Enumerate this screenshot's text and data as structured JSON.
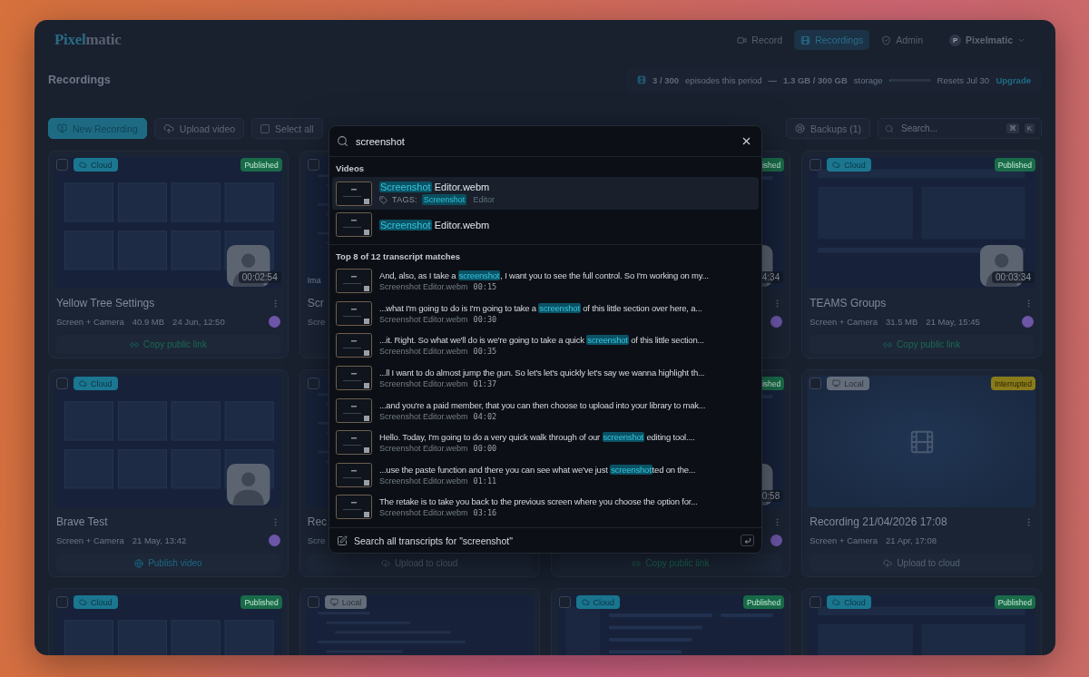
{
  "app": {
    "logo": [
      {
        "text": "Pixel",
        "accent": true
      },
      {
        "text": "matic",
        "accent": false
      }
    ],
    "nav": [
      {
        "label": "Record",
        "selected": false
      },
      {
        "label": "Recordings",
        "selected": true
      },
      {
        "label": "Admin",
        "selected": false
      }
    ],
    "user": {
      "initial": "P",
      "name": "Pixelmatic"
    }
  },
  "header": {
    "title": "Recordings",
    "usage": {
      "count": "3 / 300",
      "count_label": "episodes this period",
      "dash": "—",
      "storage": "1.3 GB / 300 GB",
      "storage_label": "storage",
      "level": 0.02,
      "resets": "Resets Jul 30",
      "upgrade": "Upgrade"
    }
  },
  "toolbar": {
    "new_recording": "New Recording",
    "upload": "Upload video",
    "select_all": {
      "label": "Select all",
      "checked": false
    },
    "backups": "Backups (1)",
    "search": {
      "placeholder": "Search...",
      "keys": [
        "⌘",
        "K"
      ]
    }
  },
  "cards": [
    {
      "checked": false,
      "storage": {
        "kind": "cloud",
        "label": "Cloud"
      },
      "status": {
        "kind": "published",
        "label": "Published"
      },
      "duration": "00:02:54",
      "title": "Yellow Tree Settings",
      "meta": [
        "Screen + Camera",
        "40.9 MB",
        "24 Jun, 12:50"
      ],
      "avatar": true,
      "menu": true,
      "action": {
        "kind": "link",
        "label": "Copy public link"
      }
    },
    {
      "checked": false,
      "thumb_tag": "Ima",
      "title": "Scr",
      "meta": [
        "Scre"
      ]
    },
    {
      "status": {
        "kind": "published",
        "label": "ished"
      },
      "duration": "4:34",
      "avatar": true,
      "menu": true
    },
    {
      "checked": false,
      "storage": {
        "kind": "cloud",
        "label": "Cloud"
      },
      "status": {
        "kind": "published",
        "label": "Published"
      },
      "duration": "00:03:34",
      "title": "TEAMS Groups",
      "meta": [
        "Screen + Camera",
        "31.5 MB",
        "21 May, 15:45"
      ],
      "avatar": true,
      "menu": true,
      "action": {
        "kind": "link",
        "label": "Copy public link"
      }
    },
    {
      "checked": false,
      "storage": {
        "kind": "cloud",
        "label": "Cloud"
      },
      "title": "Brave Test",
      "meta": [
        "Screen + Camera",
        "21 May, 13:42"
      ],
      "avatar": true,
      "menu": true,
      "action": {
        "kind": "publish",
        "label": "Publish video"
      }
    },
    {
      "checked": false,
      "title": "Rec",
      "meta": [
        "Scre"
      ],
      "action": {
        "kind": "upload",
        "label": "Upload to cloud"
      }
    },
    {
      "status": {
        "kind": "published",
        "label": "ished"
      },
      "duration": "0:58",
      "avatar": true,
      "menu": true,
      "action": {
        "kind": "link",
        "label": "Copy public link"
      }
    },
    {
      "checked": false,
      "storage": {
        "kind": "local",
        "label": "Local"
      },
      "status": {
        "kind": "interrupted",
        "label": "Interrupted"
      },
      "preview": false,
      "title": "Recording 21/04/2026 17:08",
      "meta": [
        "Screen + Camera",
        "21 Apr, 17:08"
      ],
      "menu": true,
      "action": {
        "kind": "upload",
        "label": "Upload to cloud"
      }
    },
    {
      "checked": false,
      "storage": {
        "kind": "cloud",
        "label": "Cloud"
      },
      "status": {
        "kind": "published",
        "label": "Published"
      }
    },
    {
      "checked": false,
      "storage": {
        "kind": "local",
        "label": "Local"
      }
    },
    {
      "checked": false,
      "storage": {
        "kind": "cloud",
        "label": "Cloud"
      },
      "status": {
        "kind": "published",
        "label": "Published"
      }
    },
    {
      "checked": false,
      "storage": {
        "kind": "cloud",
        "label": "Cloud"
      },
      "status": {
        "kind": "published",
        "label": "Published"
      }
    }
  ],
  "search_dialog": {
    "query": "screenshot",
    "videos_heading": "Videos",
    "videos": [
      {
        "selected": true,
        "name": [
          {
            "text": "Screenshot",
            "match": true
          },
          {
            "text": " Editor.webm",
            "match": false
          }
        ],
        "tags_label": "TAGS:",
        "tags": [
          {
            "text": "Screenshot",
            "match": true
          },
          {
            "text": "Editor",
            "match": false
          }
        ]
      },
      {
        "selected": false,
        "name": [
          {
            "text": "Screenshot",
            "match": true
          },
          {
            "text": " Editor.webm",
            "match": false
          }
        ]
      }
    ],
    "transcripts_heading": "Top 8 of 12 transcript matches",
    "transcripts": [
      {
        "selected": false,
        "text": [
          {
            "text": "And, also, as I take a ",
            "match": false
          },
          {
            "text": "screenshot",
            "match": true
          },
          {
            "text": ", I want you to see the full control. So I'm working on my...",
            "match": false
          }
        ],
        "file": "Screenshot Editor.webm",
        "time": "00:15"
      },
      {
        "selected": false,
        "text": [
          {
            "text": "...what I'm going to do is I'm going to take a ",
            "match": false
          },
          {
            "text": "screenshot",
            "match": true
          },
          {
            "text": " of this little section over here, a...",
            "match": false
          }
        ],
        "file": "Screenshot Editor.webm",
        "time": "00:30"
      },
      {
        "selected": false,
        "text": [
          {
            "text": "...it. Right. So what we'll do is we're going to take a quick ",
            "match": false
          },
          {
            "text": "screenshot",
            "match": true
          },
          {
            "text": " of this little section...",
            "match": false
          }
        ],
        "file": "Screenshot Editor.webm",
        "time": "00:35"
      },
      {
        "selected": false,
        "text": [
          {
            "text": "...ll I want to do almost jump the gun. So let's let's quickly let's say we wanna highlight th...",
            "match": false
          }
        ],
        "file": "Screenshot Editor.webm",
        "time": "01:37"
      },
      {
        "selected": false,
        "text": [
          {
            "text": "...and you're a paid member, that you can then choose to upload into your library to mak...",
            "match": false
          }
        ],
        "file": "Screenshot Editor.webm",
        "time": "04:02"
      },
      {
        "selected": false,
        "text": [
          {
            "text": "Hello. Today, I'm going to do a very quick walk through of our ",
            "match": false
          },
          {
            "text": "screenshot",
            "match": true
          },
          {
            "text": " editing tool....",
            "match": false
          }
        ],
        "file": "Screenshot Editor.webm",
        "time": "00:00"
      },
      {
        "selected": false,
        "text": [
          {
            "text": "...use the paste function and there you can see what we've just ",
            "match": false
          },
          {
            "text": "screenshot",
            "match": true
          },
          {
            "text": "ted on the...",
            "match": false
          }
        ],
        "file": "Screenshot Editor.webm",
        "time": "01:11"
      },
      {
        "selected": false,
        "text": [
          {
            "text": "The retake is to take you back to the previous screen where you choose the option for...",
            "match": false
          }
        ],
        "file": "Screenshot Editor.webm",
        "time": "03:16"
      }
    ],
    "footer": "Search all transcripts for \"screenshot\""
  }
}
